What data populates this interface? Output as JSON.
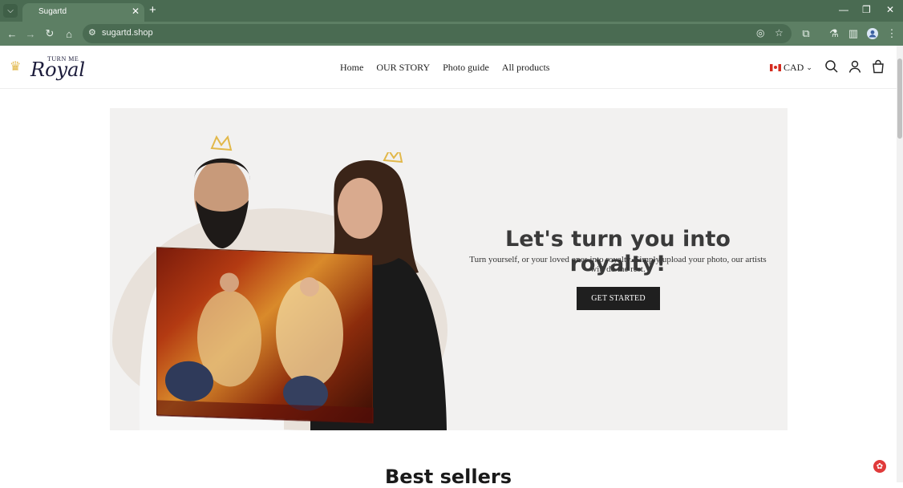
{
  "browser": {
    "tab_title": "Sugartd",
    "url": "sugartd.shop",
    "colors": {
      "frame": "#4a6b52",
      "toolbar": "#5d7f64"
    }
  },
  "site": {
    "logo_small": "TURN ME",
    "logo_big": "Royal",
    "nav": [
      "Home",
      "OUR STORY",
      "Photo guide",
      "All products"
    ],
    "currency": "CAD"
  },
  "hero": {
    "title": "Let's turn you into royalty!",
    "subtitle": "Turn yourself, or your loved ones into royalty. Simply upload your photo, our artists will do the rest.",
    "cta": "GET STARTED"
  },
  "section": {
    "title": "Best sellers"
  }
}
